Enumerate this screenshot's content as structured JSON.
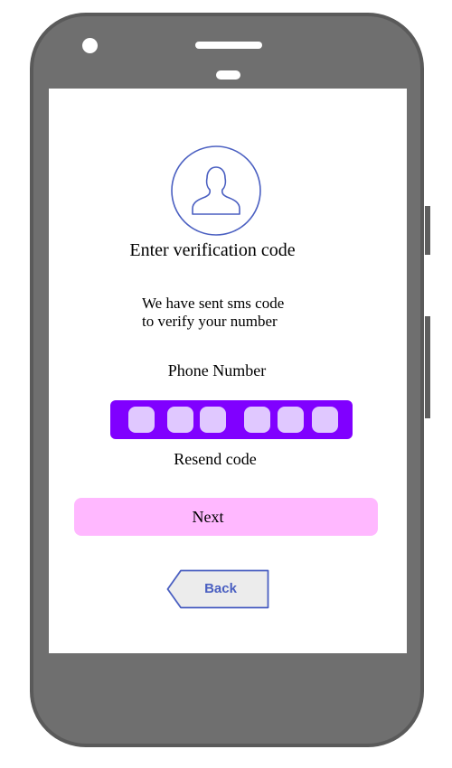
{
  "colors": {
    "device_body": "#6f6f6f",
    "screen": "#ffffff",
    "code_bar": "#8000ff",
    "code_cell": "#e0c8ff",
    "next_button": "#ffb8ff",
    "back_button_fill": "#ececec",
    "accent": "#4a5fc1"
  },
  "icons": {
    "avatar": "user-silhouette-icon"
  },
  "header": {
    "title": "Enter verification code"
  },
  "message": {
    "line1": "We have sent sms code",
    "line2": "to verify your number"
  },
  "phone": {
    "label": "Phone Number"
  },
  "code_inputs": [
    {
      "value": ""
    },
    {
      "value": ""
    },
    {
      "value": ""
    },
    {
      "value": ""
    },
    {
      "value": ""
    },
    {
      "value": ""
    }
  ],
  "actions": {
    "resend_label": "Resend code",
    "next_label": "Next",
    "back_label": "Back"
  }
}
